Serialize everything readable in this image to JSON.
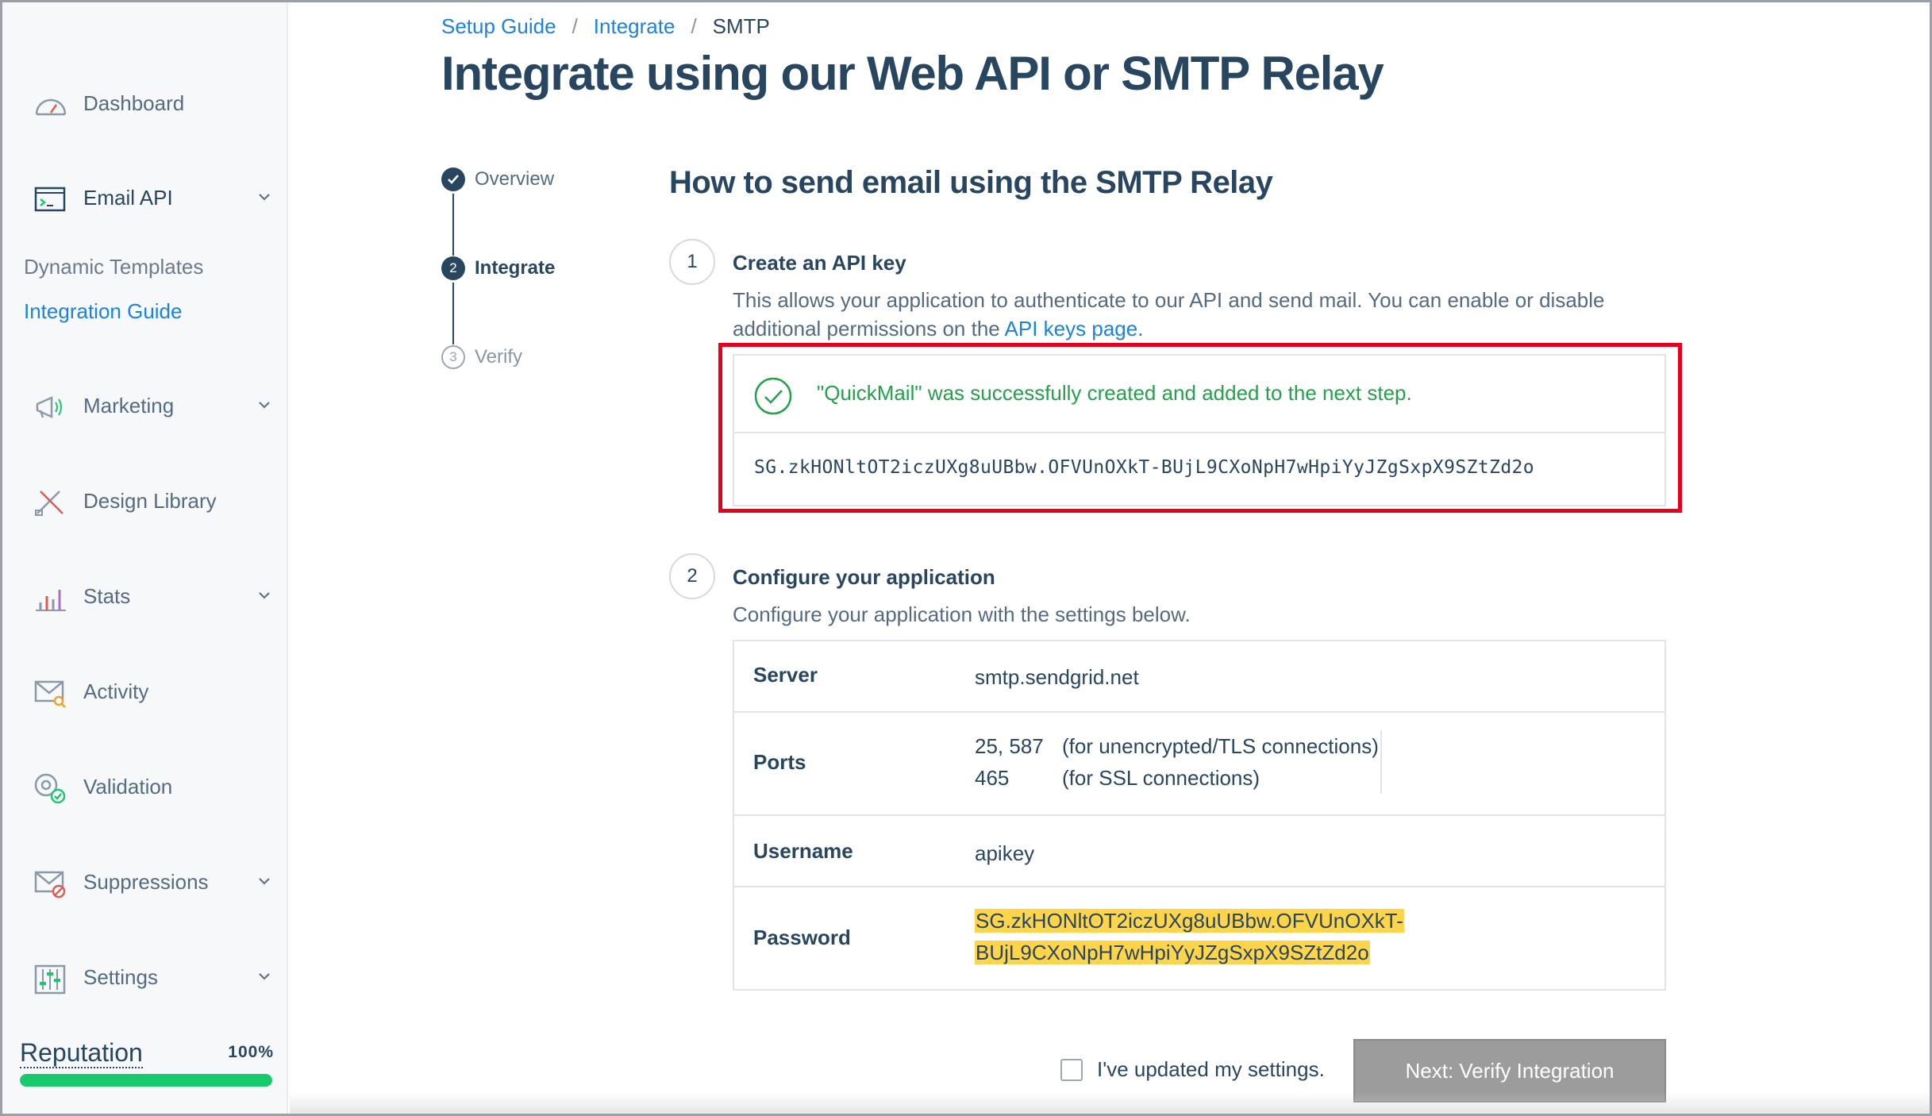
{
  "sidebar": {
    "items": [
      {
        "label": "Dashboard",
        "icon": "dashboard-gauge-icon"
      },
      {
        "label": "Email API",
        "icon": "email-api-terminal-icon"
      },
      {
        "label": "Marketing",
        "icon": "megaphone-icon"
      },
      {
        "label": "Design Library",
        "icon": "design-tools-icon"
      },
      {
        "label": "Stats",
        "icon": "bar-stats-icon"
      },
      {
        "label": "Activity",
        "icon": "envelope-search-icon"
      },
      {
        "label": "Validation",
        "icon": "at-check-icon"
      },
      {
        "label": "Suppressions",
        "icon": "envelope-block-icon"
      },
      {
        "label": "Settings",
        "icon": "sliders-icon"
      }
    ],
    "email_api_sub": {
      "dynamic_templates": "Dynamic Templates",
      "integration_guide": "Integration Guide"
    },
    "reputation": {
      "label": "Reputation",
      "value_text": "100%",
      "percent": 100
    }
  },
  "breadcrumb": {
    "setup_guide": "Setup Guide",
    "integrate": "Integrate",
    "current": "SMTP",
    "separator": "/"
  },
  "page_title": "Integrate using our Web API or SMTP Relay",
  "stepper": {
    "overview": "Overview",
    "integrate": "Integrate",
    "integrate_num": "2",
    "verify": "Verify",
    "verify_num": "3"
  },
  "section_title": "How to send email using the SMTP Relay",
  "step1": {
    "num": "1",
    "heading": "Create an API key",
    "desc_line1": "This allows your application to authenticate to our API and send mail. You can enable or disable",
    "desc_line2_prefix": "additional permissions on the ",
    "desc_link": "API keys page",
    "desc_suffix": ".",
    "success_message": "\"QuickMail\" was successfully created and added to the next step.",
    "api_key": "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"
  },
  "step2": {
    "num": "2",
    "heading": "Configure your application",
    "desc": "Configure your application with the settings below.",
    "table": {
      "server_key": "Server",
      "server_val": "smtp.sendgrid.net",
      "ports_key": "Ports",
      "ports": [
        {
          "port": "25, 587",
          "note": "(for unencrypted/TLS connections)"
        },
        {
          "port": "465",
          "note": "(for SSL connections)"
        }
      ],
      "username_key": "Username",
      "username_val": "apikey",
      "password_key": "Password",
      "password_line1": "SG.zkHONltOT2iczUXg8uUBbw.OFVUnOXkT-",
      "password_line2": "BUjL9CXoNpH7wHpiYyJZgSxpX9SZtZd2o"
    }
  },
  "footer": {
    "checkbox_label": "I've updated my settings.",
    "next_button": "Next: Verify Integration"
  },
  "colors": {
    "brand_blue": "#1a82e2",
    "navy": "#294661",
    "success_green": "#22a24a",
    "highlight_red": "#e8001c",
    "password_yellow": "#fed54a",
    "reputation_green": "#18c96e",
    "disabled_button": "#9c9c9c"
  }
}
